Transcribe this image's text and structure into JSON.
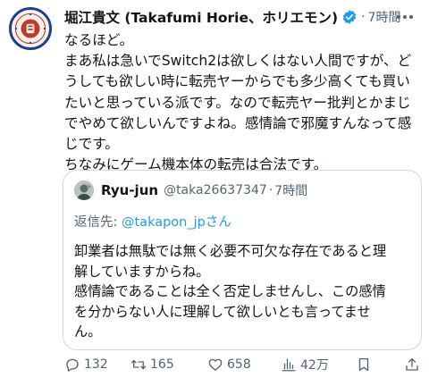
{
  "tweet": {
    "author": {
      "name": "堀江貴文 (Takafumi Horie、ホリエモン)",
      "verified_color": "#1d9bf0",
      "avatar_icon": "avatar-emblem-icon"
    },
    "dot": "·",
    "time": "7時間",
    "lines": [
      "なるほど。",
      "まあ私は急いでSwitch2は欲しくはない人間ですが、ど",
      "うしても欲しい時に転売ヤーからでも多少高くても買い",
      "たいと思っている派です。なので転売ヤー批判とかまじ",
      "でやめて欲しいんですよね。感情論で邪魔すんなって感",
      "じです。",
      "ちなみにゲーム機本体の転売は合法です。"
    ]
  },
  "quote": {
    "name": "Ryu-jun",
    "handle": "@taka26637347",
    "dot": "·",
    "time": "7時間",
    "reply_prefix": "返信先: ",
    "reply_mention": "@takapon_jp",
    "reply_suffix": "さん",
    "lines": [
      "卸業者は無駄では無く必要不可欠な存在であると理",
      "解していますからね。",
      "感情論であることは全く否定しませんし、この感情",
      "を分からない人に理解して欲しいとも言ってませ",
      "ん。"
    ]
  },
  "actions": {
    "replies": "132",
    "retweets": "165",
    "likes": "658",
    "views": "42万"
  },
  "colors": {
    "text": "#0f1419",
    "secondary": "#536471",
    "link": "#1d9bf0",
    "border": "#cfd9de",
    "avatar_ring": "#1f3f8f"
  }
}
